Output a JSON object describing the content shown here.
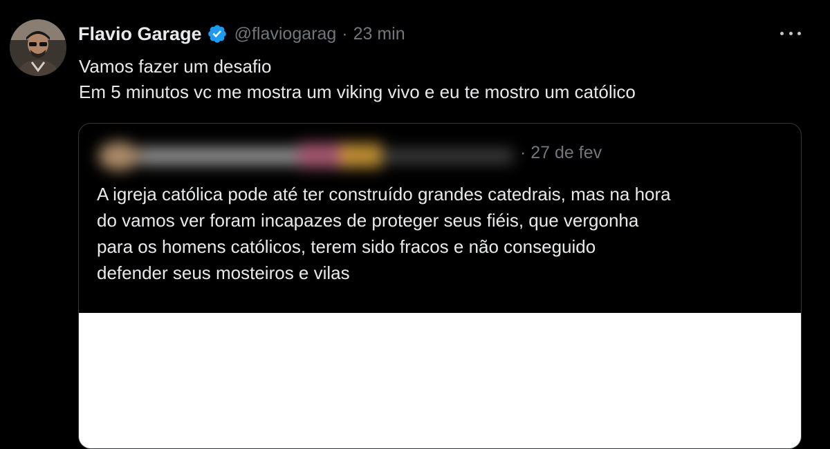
{
  "tweet": {
    "author": {
      "display_name": "Flavio Garage",
      "handle": "@flaviogarag",
      "verified": true,
      "avatar_icon": "user-avatar"
    },
    "separator": "·",
    "time": "23 min",
    "more_icon": "more-options-icon",
    "text_lines": [
      "Vamos fazer um desafio",
      "Em 5 minutos vc me mostra um viking vivo e eu te mostro um católico"
    ]
  },
  "quoted_tweet": {
    "date": "· 27 de fev",
    "text_lines": [
      "A igreja católica pode até ter construído grandes catedrais, mas na hora",
      "do vamos ver foram incapazes de proteger seus fiéis, que vergonha",
      "para os homens católicos, terem sido fracos e não conseguido",
      "defender seus mosteiros e vilas"
    ]
  },
  "colors": {
    "background": "#000000",
    "primary_text": "#e7e9ea",
    "secondary_text": "#71767b",
    "verified_badge": "#1d9bf0",
    "quote_border": "#333639"
  }
}
